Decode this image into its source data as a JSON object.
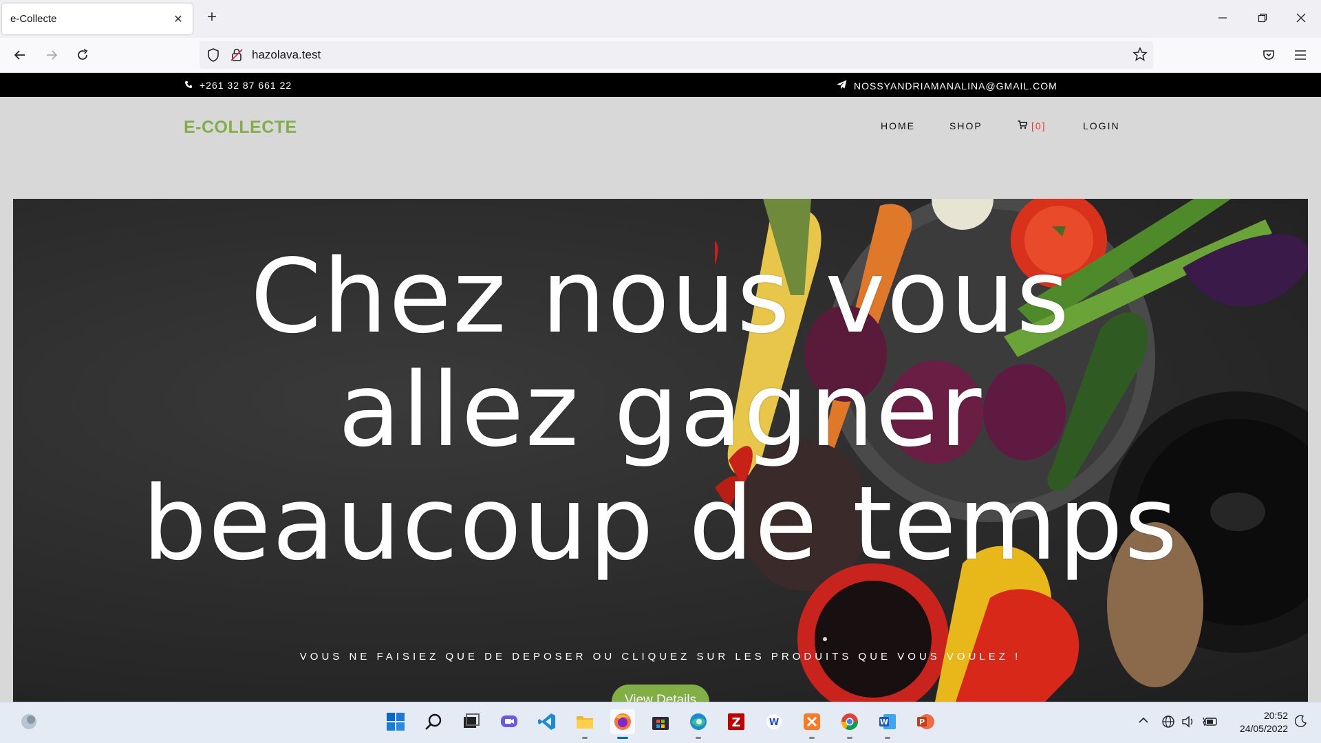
{
  "browser": {
    "tab_title": "e-Collecte",
    "url": "hazolava.test"
  },
  "topbar": {
    "phone": "+261 32 87 661 22",
    "email": "NOSSYANDRIAMANALINA@GMAIL.COM"
  },
  "header": {
    "logo": "E-COLLECTE",
    "nav": {
      "home": "HOME",
      "shop": "SHOP",
      "cart": "[0]",
      "login": "LOGIN"
    }
  },
  "hero": {
    "title_line1": "Chez nous vous",
    "title_line2": "allez gagner",
    "title_line3": "beaucoup de temps",
    "subtitle": "VOUS NE FAISIEZ QUE DE DEPOSER OU CLIQUEZ SUR LES PRODUITS QUE VOUS VOULEZ !",
    "button": "View Details"
  },
  "taskbar": {
    "time": "20:52",
    "date": "24/05/2022",
    "apps": [
      "start-icon",
      "search-icon",
      "task-view-icon",
      "chat-icon",
      "vscode-icon",
      "file-explorer-icon",
      "firefox-icon",
      "store-icon",
      "edge-icon",
      "filezilla-icon",
      "app-icon",
      "xampp-icon",
      "chrome-icon",
      "word-icon",
      "powerpoint-icon"
    ]
  },
  "colors": {
    "brand": "#82ae46",
    "cart": "#e53935",
    "topbar": "#000000"
  }
}
